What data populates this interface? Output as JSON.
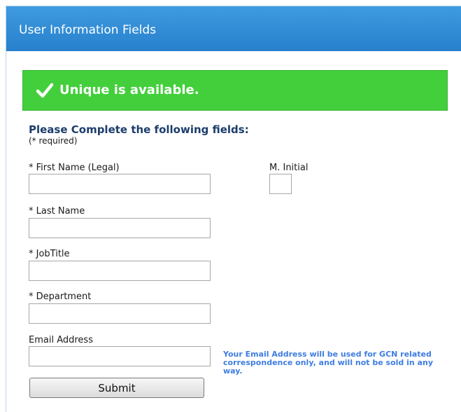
{
  "header": {
    "title": "User Information Fields"
  },
  "banner": {
    "icon": "checkmark-icon",
    "message": "Unique is available.",
    "color": "#43cf3c"
  },
  "form": {
    "instructions": "Please Complete the following fields:",
    "required_note": "(* required)",
    "fields": {
      "first_name": {
        "label": "* First Name (Legal)",
        "value": ""
      },
      "middle_initial": {
        "label": "M. Initial",
        "value": ""
      },
      "last_name": {
        "label": "* Last Name",
        "value": ""
      },
      "job_title": {
        "label": "* JobTitle",
        "value": ""
      },
      "department": {
        "label": "* Department",
        "value": ""
      },
      "email": {
        "label": "Email Address",
        "value": ""
      }
    },
    "email_note": "Your Email Address will be used for GCN related correspondence only, and will not be sold in any way.",
    "submit_label": "Submit"
  },
  "colors": {
    "header": "#2f8bd6",
    "success": "#43cf3c",
    "heading_text": "#1c3d6b",
    "note_text": "#3e7de0"
  }
}
